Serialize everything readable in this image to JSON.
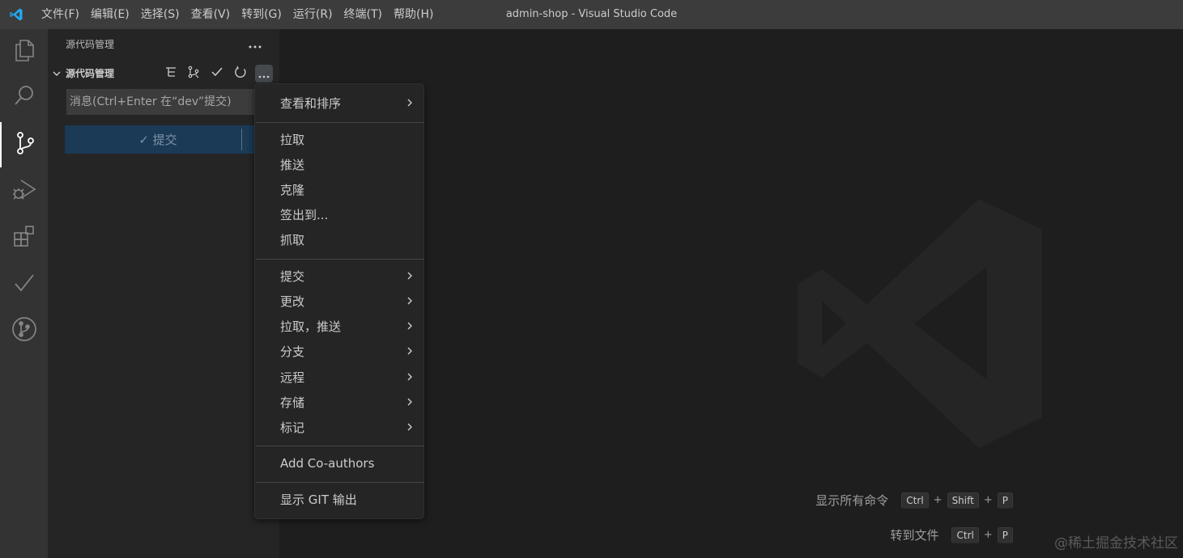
{
  "titlebar": {
    "window_title": "admin-shop - Visual Studio Code",
    "menus": [
      "文件(F)",
      "编辑(E)",
      "选择(S)",
      "查看(V)",
      "转到(G)",
      "运行(R)",
      "终端(T)",
      "帮助(H)"
    ]
  },
  "activitybar": {
    "items": [
      {
        "icon": "files-icon",
        "active": false
      },
      {
        "icon": "search-icon",
        "active": false
      },
      {
        "icon": "source-control-icon",
        "active": true
      },
      {
        "icon": "run-debug-icon",
        "active": false
      },
      {
        "icon": "extensions-icon",
        "active": false
      },
      {
        "icon": "check-icon",
        "active": false
      },
      {
        "icon": "git-graph-icon",
        "active": false
      }
    ]
  },
  "sidebar": {
    "title": "源代码管理",
    "section_label": "源代码管理",
    "actions": [
      "tree-view-icon",
      "branch-icon",
      "commit-check-icon",
      "refresh-icon",
      "more-actions-icon"
    ],
    "commit_placeholder": "消息(Ctrl+Enter 在“dev”提交)",
    "commit_button": "✓ 提交"
  },
  "context_menu": {
    "groups": [
      [
        {
          "label": "查看和排序",
          "submenu": true
        }
      ],
      [
        {
          "label": "拉取",
          "submenu": false
        },
        {
          "label": "推送",
          "submenu": false
        },
        {
          "label": "克隆",
          "submenu": false
        },
        {
          "label": "签出到...",
          "submenu": false
        },
        {
          "label": "抓取",
          "submenu": false
        }
      ],
      [
        {
          "label": "提交",
          "submenu": true
        },
        {
          "label": "更改",
          "submenu": true
        },
        {
          "label": "拉取，推送",
          "submenu": true
        },
        {
          "label": "分支",
          "submenu": true
        },
        {
          "label": "远程",
          "submenu": true
        },
        {
          "label": "存储",
          "submenu": true
        },
        {
          "label": "标记",
          "submenu": true
        }
      ],
      [
        {
          "label": "Add Co-authors",
          "submenu": false
        }
      ],
      [
        {
          "label": "显示 GIT 输出",
          "submenu": false
        }
      ]
    ]
  },
  "editor": {
    "shortcuts": [
      {
        "label": "显示所有命令",
        "keys": [
          "Ctrl",
          "Shift",
          "P"
        ]
      },
      {
        "label": "转到文件",
        "keys": [
          "Ctrl",
          "P"
        ]
      }
    ],
    "watermark_text": "@稀土掘金技术社区"
  },
  "colors": {
    "accent": "#007acc",
    "titlebar_bg": "#3c3c3c",
    "activitybar_bg": "#333333",
    "sidebar_bg": "#252526",
    "editor_bg": "#1e1e1e",
    "commit_button_bg": "#1a3a56"
  }
}
